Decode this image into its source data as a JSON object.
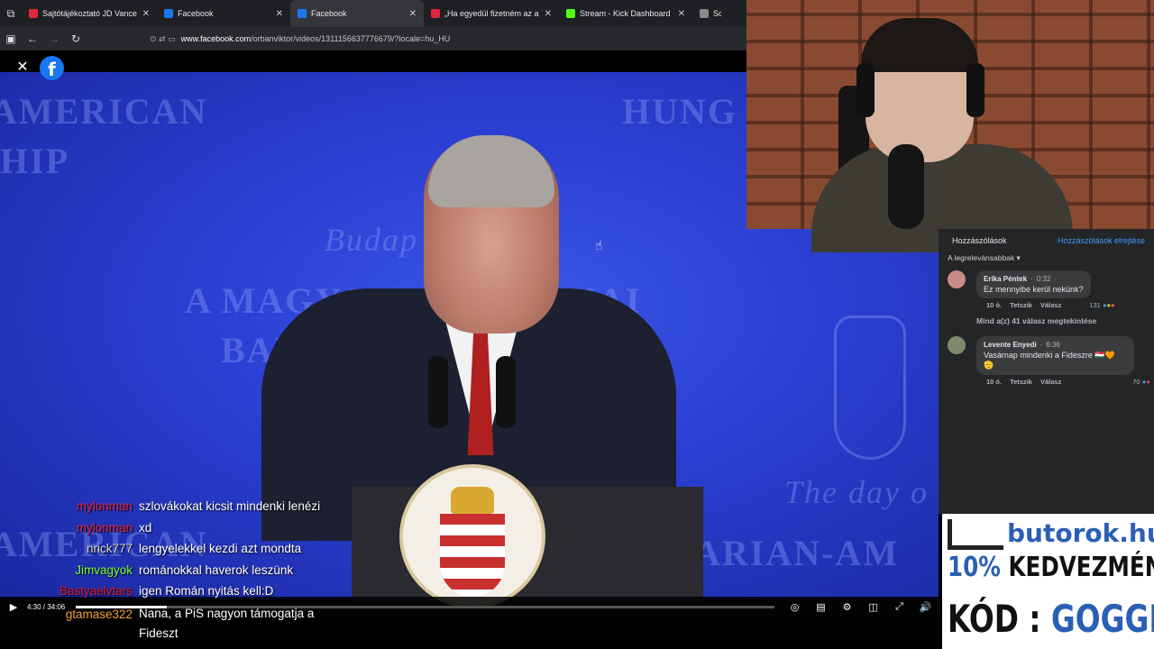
{
  "browser": {
    "tabs": [
      {
        "title": "Sajtótájékoztató JD Vance amer",
        "color": "#e0263c",
        "active": false
      },
      {
        "title": "Facebook",
        "color": "#1877f2",
        "active": false
      },
      {
        "title": "Facebook",
        "color": "#1877f2",
        "active": true
      },
      {
        "title": "„Ha egyedül fizetném az albérle",
        "color": "#e0263c",
        "active": false
      },
      {
        "title": "Stream - Kick Dashboard",
        "color": "#53fc18",
        "active": false
      },
      {
        "title": "Screenshot",
        "color": "#888888",
        "active": false
      }
    ],
    "url_host": "www.facebook.com",
    "url_path": "/orbanviktor/videos/1311156637776679/?locale=hu_HU"
  },
  "video": {
    "bg_texts": [
      "AMERICAN",
      "HIP",
      "HUNG",
      "A MAGYAR",
      "KAI",
      "BARÁ",
      "Budap",
      "The day o",
      "AMERICAN",
      "ARIAN-AM"
    ],
    "time": "4:30 / 34:06",
    "progress": 0.13
  },
  "chat": [
    {
      "user": "mylonman",
      "color": "#e3243b",
      "msg": "szlovákokat kicsit mindenki lenézi"
    },
    {
      "user": "mylonman",
      "color": "#e3243b",
      "msg": "xd"
    },
    {
      "user": "nrick777",
      "color": "#d7d7d7",
      "msg": "lengyelekkel kezdi azt mondta"
    },
    {
      "user": "Jimvagyok",
      "color": "#7cfc3b",
      "msg": "románokkal haverok leszünk"
    },
    {
      "user": "Bastyaelvtars",
      "color": "#d61c2c",
      "msg": "igen Román nyitás kell:D"
    },
    {
      "user": "gtamase322",
      "color": "#f2a23a",
      "msg": "Nana, a PiS nagyon támogatja a Fideszt"
    }
  ],
  "comments": {
    "header": "Hozzászólások",
    "hide": "Hozzászólások elrejtése",
    "sort": "A legrelevánsabbak ▾",
    "items": [
      {
        "name": "Erika Péntek",
        "time": "0:32",
        "text": "Ez mennyibe kerül nekünk?",
        "age": "10 ó.",
        "like": "Tetszik",
        "reply": "Válasz",
        "reacts": "131",
        "avatar": "#c98a8a"
      },
      {
        "name": "Levente Enyedi",
        "time": "6:36",
        "text": "Vasárnap mindenki a Fideszre 🇭🇺🧡 🫡",
        "age": "10 ó.",
        "like": "Tetszik",
        "reply": "Válasz",
        "reacts": "70",
        "avatar": "#7d8a6e"
      }
    ],
    "replies_link": "Mind a(z) 41 válasz megtekintése"
  },
  "sponsor": {
    "brand": "butorok.hu",
    "line1_a": "10% ",
    "line1_b": "KEDVEZMÉNY",
    "line2_a": "KÓD : ",
    "line2_b": "GOGGER"
  }
}
